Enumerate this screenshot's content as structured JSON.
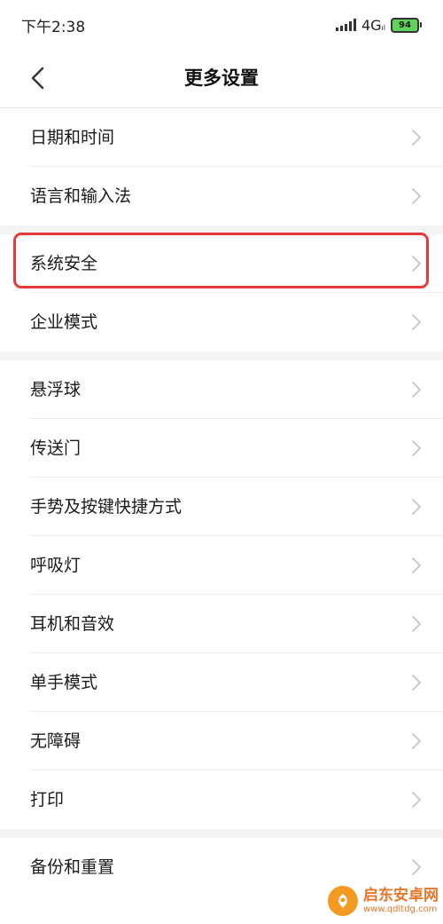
{
  "status_bar": {
    "time": "下午2:38",
    "network": "4G",
    "network_suffix": "ıl",
    "battery": "94"
  },
  "header": {
    "title": "更多设置"
  },
  "groups": [
    {
      "items": [
        "日期和时间",
        "语言和输入法"
      ]
    },
    {
      "items": [
        "系统安全",
        "企业模式"
      ]
    },
    {
      "items": [
        "悬浮球",
        "传送门",
        "手势及按键快捷方式",
        "呼吸灯",
        "耳机和音效",
        "单手模式",
        "无障碍",
        "打印"
      ]
    },
    {
      "items": [
        "备份和重置"
      ]
    }
  ],
  "highlight_color": "#e43a3a",
  "watermark": {
    "name": "启东安卓网",
    "url": "www.qdltdg.com"
  }
}
